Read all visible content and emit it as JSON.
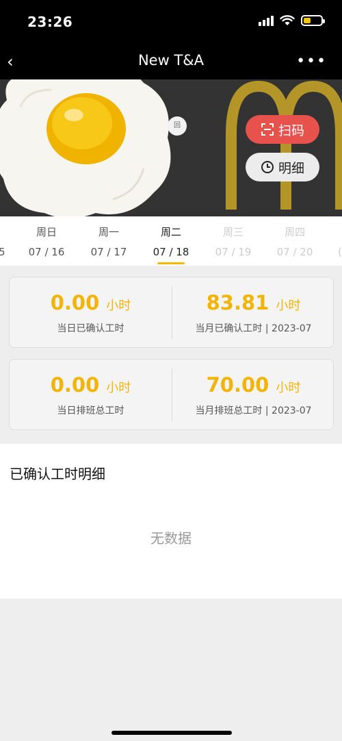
{
  "status_bar": {
    "time": "23:26",
    "battery_color": "#f5c518"
  },
  "nav": {
    "back_glyph": "‹",
    "title": "New T&A",
    "more_glyph": "•••"
  },
  "hero": {
    "scan_label": "扫码",
    "detail_label": "明细",
    "brand_color": "#b39528",
    "tag_text": "回"
  },
  "week": {
    "left_edge": "5",
    "days": [
      {
        "name": "周日",
        "date": "07 / 16",
        "state": "past"
      },
      {
        "name": "周一",
        "date": "07 / 17",
        "state": "past"
      },
      {
        "name": "周二",
        "date": "07 / 18",
        "state": "selected"
      },
      {
        "name": "周三",
        "date": "07 / 19",
        "state": "future"
      },
      {
        "name": "周四",
        "date": "07 / 20",
        "state": "future"
      }
    ],
    "right_edge": "(",
    "accent_color": "#f5b800"
  },
  "summary": [
    {
      "left": {
        "value": "0.00",
        "unit": "小时",
        "label": "当日已确认工时"
      },
      "right": {
        "value": "83.81",
        "unit": "小时",
        "label": "当月已确认工时 | 2023-07"
      }
    },
    {
      "left": {
        "value": "0.00",
        "unit": "小时",
        "label": "当日排班总工时"
      },
      "right": {
        "value": "70.00",
        "unit": "小时",
        "label": "当月排班总工时 | 2023-07"
      }
    }
  ],
  "detail": {
    "title": "已确认工时明细",
    "empty_text": "无数据"
  }
}
